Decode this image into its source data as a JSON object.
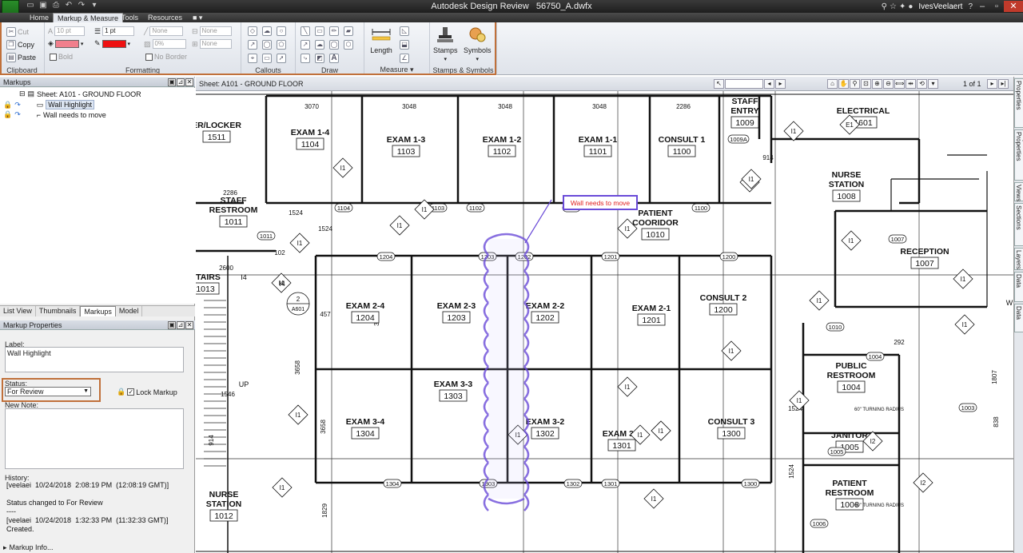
{
  "titlebar": {
    "app": "Autodesk Design Review",
    "file": "56750_A.dwfx",
    "logo": "REV",
    "user": "IvesVeelaert"
  },
  "menu": [
    {
      "label": "Home",
      "active": false
    },
    {
      "label": "Markup & Measure",
      "active": true
    },
    {
      "label": "Tools",
      "active": false
    },
    {
      "label": "Resources",
      "active": false
    }
  ],
  "ribbon": {
    "clipboard": {
      "title": "Clipboard",
      "cut": "Cut",
      "copy": "Copy",
      "paste": "Paste"
    },
    "formatting": {
      "title": "Formatting",
      "font_size": "10 pt",
      "bold": "Bold",
      "line_width": "1 pt",
      "line_style": "None",
      "transparency": "0%",
      "border": "None",
      "fill": "None",
      "no_border": "No Border"
    },
    "callouts": {
      "title": "Callouts"
    },
    "draw": {
      "title": "Draw"
    },
    "measure": {
      "title": "Measure",
      "length": "Length"
    },
    "stamps": {
      "title": "Stamps & Symbols",
      "stamps": "Stamps",
      "symbols": "Symbols"
    }
  },
  "colors": {
    "accent_frame": "#c0703a",
    "fill_swatch": "#f07f8c",
    "line_swatch": "#ee1111",
    "markup": "#6a4bd8",
    "markup_label": "#e02020"
  },
  "markups_panel": {
    "title": "Markups",
    "sheet": "Sheet: A101 - GROUND FLOOR",
    "items": [
      "Wall Highlight",
      "Wall needs to move"
    ]
  },
  "bottom_tabs": [
    "List View",
    "Thumbnails",
    "Markups",
    "Model"
  ],
  "properties": {
    "title": "Markup Properties",
    "label_caption": "Label:",
    "label_value": "Wall Highlight",
    "status_caption": "Status:",
    "status_value": "For Review",
    "lock_label": "Lock Markup",
    "new_note_caption": "New Note:",
    "history_caption": "History:",
    "history": "[veelaei  10/24/2018  2:08:19 PM  (12:08:19 GMT)]\n\nStatus changed to For Review\n----\n[veelaei  10/24/2018  1:32:33 PM  (11:32:33 GMT)]\nCreated.",
    "footer": "Markup Info..."
  },
  "sheetbar": {
    "title": "Sheet: A101 - GROUND FLOOR",
    "page": "1 of 1"
  },
  "right_tabs": [
    "Sheet Properties",
    "Object Properties",
    "Views",
    "Cross Sections",
    "Layers",
    "Text Data",
    "Grid Data"
  ],
  "drawing": {
    "rooms": [
      {
        "name": "EXAM 1-4",
        "num": "1104"
      },
      {
        "name": "EXAM 1-3",
        "num": "1103"
      },
      {
        "name": "EXAM 1-2",
        "num": "1102"
      },
      {
        "name": "EXAM 1-1",
        "num": "1101"
      },
      {
        "name": "CONSULT 1",
        "num": "1100"
      },
      {
        "name": "STAFF",
        "name2": "ENTRY",
        "num": "1009"
      },
      {
        "name": "ELECTRICAL",
        "num": "1601"
      },
      {
        "name": "ER/LOCKER",
        "num": "1511"
      },
      {
        "name": "STAFF",
        "name2": "RESTROOM",
        "num": "1011"
      },
      {
        "name": "PATIENT",
        "name2": "COORIDOR",
        "num": "1010"
      },
      {
        "name": "NURSE",
        "name2": "STATION",
        "num": "1008"
      },
      {
        "name": "RECEPTION",
        "num": "1007"
      },
      {
        "name": "EXAM 2-4",
        "num": "1204"
      },
      {
        "name": "EXAM 2-3",
        "num": "1203"
      },
      {
        "name": "EXAM 2-2",
        "num": "1202"
      },
      {
        "name": "EXAM 2-1",
        "num": "1201"
      },
      {
        "name": "CONSULT 2",
        "num": "1200"
      },
      {
        "name": "STAIRS",
        "num": "1013"
      },
      {
        "name": "EXAM 3-3",
        "num": "1303"
      },
      {
        "name": "EXAM 3-4",
        "num": "1304"
      },
      {
        "name": "EXAM 3-2",
        "num": "1302"
      },
      {
        "name": "EXAM 3-1",
        "num": "1301"
      },
      {
        "name": "CONSULT 3",
        "num": "1300"
      },
      {
        "name": "PUBLIC",
        "name2": "RESTROOM",
        "num": "1004"
      },
      {
        "name": "JANITOR",
        "num": "1005"
      },
      {
        "name": "PATIENT",
        "name2": "RESTROOM",
        "num": "1006"
      },
      {
        "name": "NURSE",
        "name2": "STATION",
        "num": "1012"
      }
    ],
    "dims": [
      "3070",
      "3048",
      "3048",
      "3048",
      "2286",
      "2286",
      "2600",
      "1524",
      "914",
      "1524",
      "457",
      "3658",
      "3658",
      "1546",
      "914",
      "1524",
      "1829",
      "292",
      "1524",
      "1807",
      "838",
      "3658",
      "102"
    ],
    "door_tags": [
      "1104",
      "1103",
      "1102",
      "1101",
      "1100",
      "1011",
      "1204",
      "1203",
      "1202",
      "1201",
      "1200",
      "1010",
      "1304",
      "1303",
      "1302",
      "1301",
      "1300",
      "1007",
      "1004",
      "1003",
      "1005",
      "1006",
      "1009A"
    ],
    "diamonds": [
      "I1",
      "I1",
      "I1",
      "I1",
      "I1",
      "I1",
      "I1",
      "I1",
      "I1",
      "I1",
      "I1",
      "I1",
      "I1",
      "I1",
      "I1",
      "I1",
      "I1",
      "I1",
      "I1",
      "I1",
      "I1",
      "I1",
      "I2",
      "I2",
      "I4",
      "E1"
    ],
    "section_marker": {
      "num": "2",
      "sheet": "A601"
    },
    "callout_text": "Wall needs to move",
    "misc_text": [
      "I4",
      "I4",
      "UP",
      "60\" TURNING RADIUS",
      "60\" TURNING RADIUS",
      "W"
    ]
  }
}
